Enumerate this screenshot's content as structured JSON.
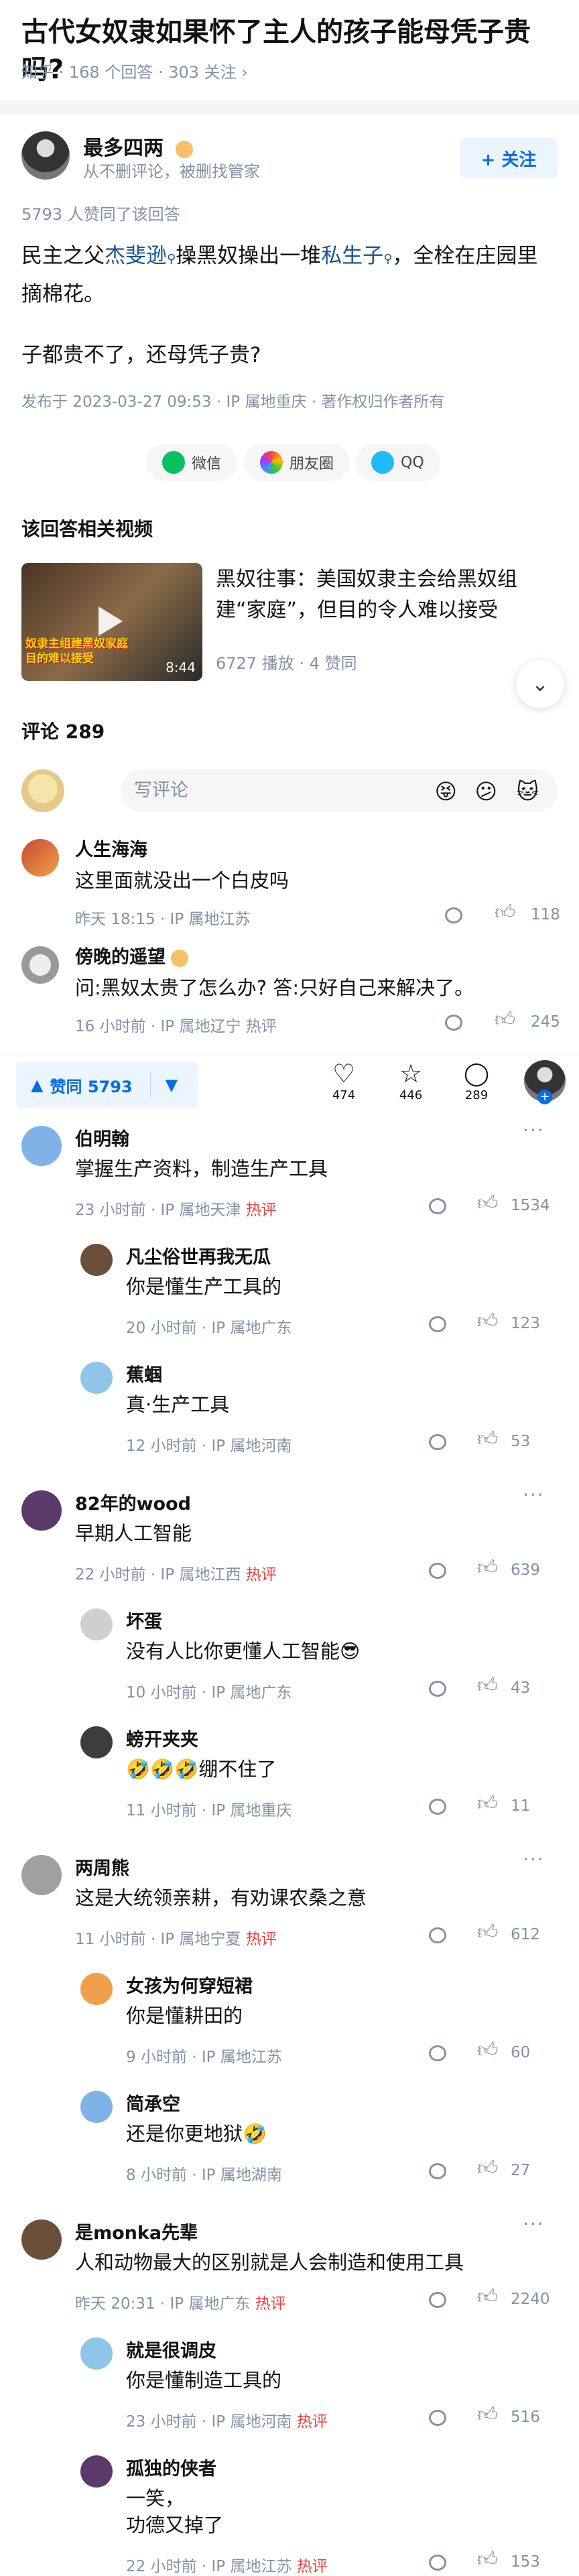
{
  "question": {
    "title": "古代女奴隶如果怀了主人的孩子能母凭子贵吗?",
    "meta": "知乎 · 168 个回答 · 303 关注 ›"
  },
  "author": {
    "name": "最多四两",
    "subtitle": "从不删评论，被删找管家",
    "follow_label": "+ 关注"
  },
  "answer": {
    "upvote_note": "5793 人赞同了该回答",
    "para1_a": "民主之父",
    "para1_link": "杰斐逊",
    "para1_b": "操黑奴操出一堆",
    "para1_link2": "私生子",
    "para1_c": "，全栓在庄园里摘棉花。",
    "para2": "子都贵不了，还母凭子贵?",
    "published": "发布于 2023-03-27 09:53 · IP 属地重庆 · 著作权归作者所有"
  },
  "share": {
    "wechat": "微信",
    "moments": "朋友圈",
    "qq": "QQ"
  },
  "related": {
    "title": "该回答相关视频",
    "video_title": "黑奴往事：美国奴隶主会给黑奴组建“家庭”，但目的令人难以接受",
    "video_duration": "8:44",
    "video_stats": "6727 播放 · 4 赞同",
    "thumb_caption": "奴隶主组建黑奴家庭\n目的难以接受"
  },
  "comments_header": {
    "title": "评论 289",
    "placeholder": "写评论"
  },
  "bottom_bar": {
    "vote_label": "赞同 5793",
    "likes": "474",
    "favorites": "446",
    "comments": "289"
  },
  "comments": [
    {
      "name": "人生海海",
      "text": "这里面就没出一个白皮吗",
      "meta": "昨天 18:15 · IP 属地江苏",
      "hot": "",
      "count": "118"
    },
    {
      "name": "傍晚的遥望",
      "text": "问:黑奴太贵了怎么办? 答:只好自己来解决了。",
      "meta": "16 小时前 · IP 属地辽宁 热评",
      "hot": "",
      "count": "245"
    }
  ],
  "threads": [
    {
      "name": "伯明翰",
      "text": "掌握生产资料，制造生产工具",
      "time": "23 小时前 · IP 属地天津",
      "hot": "热评",
      "count": "1534",
      "replies": [
        {
          "name": "凡尘俗世再我无瓜",
          "text": "你是懂生产工具的",
          "time": "20 小时前 · IP 属地广东",
          "hot": "",
          "count": "123"
        },
        {
          "name": "蕉蝈",
          "text": "真·生产工具",
          "time": "12 小时前 · IP 属地河南",
          "hot": "",
          "count": "53"
        }
      ]
    },
    {
      "name": "82年的wood",
      "text": "早期人工智能",
      "time": "22 小时前 · IP 属地江西",
      "hot": "热评",
      "count": "639",
      "replies": [
        {
          "name": "坏蛋",
          "text": "没有人比你更懂人工智能😎",
          "time": "10 小时前 · IP 属地广东",
          "hot": "",
          "count": "43"
        },
        {
          "name": "螃开夹夹",
          "text": "🤣🤣🤣绷不住了",
          "time": "11 小时前 · IP 属地重庆",
          "hot": "",
          "count": "11"
        }
      ]
    },
    {
      "name": "两周熊",
      "text": "这是大统领亲耕，有劝课农桑之意",
      "time": "11 小时前 · IP 属地宁夏",
      "hot": "热评",
      "count": "612",
      "replies": [
        {
          "name": "女孩为何穿短裙",
          "text": "你是懂耕田的",
          "time": "9 小时前 · IP 属地江苏",
          "hot": "",
          "count": "60"
        },
        {
          "name": "简承空",
          "text": "还是你更地狱🤣",
          "time": "8 小时前 · IP 属地湖南",
          "hot": "",
          "count": "27"
        }
      ]
    },
    {
      "name": "是monka先辈",
      "text": "人和动物最大的区别就是人会制造和使用工具",
      "time": "昨天 20:31 · IP 属地广东",
      "hot": "热评",
      "count": "2240",
      "replies": [
        {
          "name": "就是很调皮",
          "text": "你是懂制造工具的",
          "time": "23 小时前 · IP 属地河南",
          "hot": "热评",
          "count": "516"
        },
        {
          "name": "孤独的侠者",
          "text": "一笑，\n功德又掉了",
          "time": "22 小时前 · IP 属地江苏",
          "hot": "热评",
          "count": "153"
        }
      ]
    }
  ]
}
